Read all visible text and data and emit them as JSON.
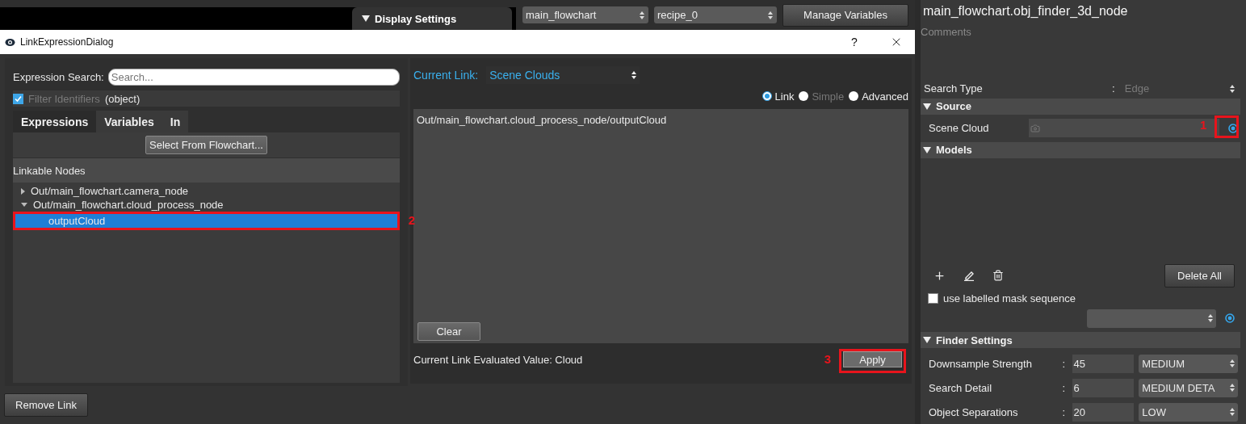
{
  "app_toolbar": {
    "section_tab": {
      "label": "Display Settings",
      "expanded": true
    },
    "dropdowns": [
      "main_flowchart",
      "recipe_0"
    ],
    "button": "Manage Variables"
  },
  "dialog": {
    "title": "LinkExpressionDialog",
    "help": "?",
    "search": {
      "label": "Expression Search:",
      "placeholder": "Search..."
    },
    "filter": {
      "label": "Filter Identifiers",
      "checked": true,
      "value": "(object)"
    },
    "tabs": [
      {
        "label": "Expressions",
        "selected": true
      },
      {
        "label": "Variables",
        "selected": false
      },
      {
        "label": "In",
        "selected": false
      }
    ],
    "select_button": "Select From Flowchart...",
    "tree_header": "Linkable Nodes",
    "tree": [
      {
        "label": "Out/main_flowchart.camera_node",
        "expanded": false,
        "selected": false
      },
      {
        "label": "Out/main_flowchart.cloud_process_node",
        "expanded": true,
        "selected": false,
        "children": [
          {
            "label": "outputCloud",
            "selected": true,
            "annotation": "2"
          }
        ]
      }
    ],
    "current_link": {
      "label": "Current Link:",
      "value": "Scene Clouds"
    },
    "modes": [
      {
        "label": "Link",
        "selected": true,
        "disabled": false
      },
      {
        "label": "Simple",
        "selected": false,
        "disabled": true
      },
      {
        "label": "Advanced",
        "selected": false,
        "disabled": false
      }
    ],
    "expression": "Out/main_flowchart.cloud_process_node/outputCloud",
    "clear_button": "Clear",
    "evaluated": "Current Link Evaluated Value: Cloud",
    "apply_button": {
      "label": "Apply",
      "annotation": "3"
    },
    "remove_button": "Remove Link"
  },
  "properties": {
    "title": "main_flowchart.obj_finder_3d_node",
    "comments": {
      "placeholder": "Comments"
    },
    "search_type": {
      "label": "Search Type",
      "separator": ":",
      "value": "Edge"
    },
    "source": {
      "title": "Source",
      "expanded": true,
      "scene_cloud": {
        "label": "Scene Cloud",
        "annotation": "1"
      }
    },
    "models": {
      "title": "Models",
      "expanded": true,
      "delete_button": "Delete All",
      "mask_checkbox": {
        "label": "use labelled mask sequence",
        "checked": false
      }
    },
    "finder": {
      "title": "Finder Settings",
      "expanded": true,
      "rows": [
        {
          "label": "Downsample Strength",
          "separator": ":",
          "value": "45",
          "level_name": "MEDIUM"
        },
        {
          "label": "Search Detail",
          "separator": ":",
          "value": "6",
          "level_name": "MEDIUM DETA"
        },
        {
          "label": "Object Separations",
          "separator": ":",
          "value": "20",
          "level_name": "LOW"
        }
      ]
    }
  }
}
